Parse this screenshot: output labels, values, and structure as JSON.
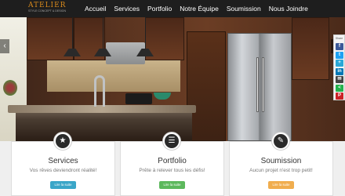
{
  "logo": {
    "name": "ATELIER",
    "tagline": "STYLE CONCEPT & DESIGN"
  },
  "nav": {
    "items": [
      "Accueil",
      "Services",
      "Portfolio",
      "Notre Équipe",
      "Soumission",
      "Nous Joindre"
    ]
  },
  "hero": {
    "prev_icon": "chevron-left-icon",
    "next_icon": "chevron-right-icon"
  },
  "share": {
    "label": "Share",
    "buttons": [
      {
        "icon": "facebook-icon",
        "glyph": "f",
        "color": "#3b5998"
      },
      {
        "icon": "twitter-icon",
        "glyph": "t",
        "color": "#1da1f2"
      },
      {
        "icon": "share-icon",
        "glyph": "+",
        "color": "#2aa7d6"
      },
      {
        "icon": "linkedin-icon",
        "glyph": "in",
        "color": "#0077b5"
      },
      {
        "icon": "email-icon",
        "glyph": "✉",
        "color": "#444444"
      },
      {
        "icon": "sharethis-icon",
        "glyph": "<",
        "color": "#22b14c"
      },
      {
        "icon": "pinterest-icon",
        "glyph": "P",
        "color": "#cb2027"
      }
    ]
  },
  "features": [
    {
      "icon": "star-icon",
      "title": "Services",
      "desc": "Vos rêves deviendront réalité!",
      "button": "Lire la suite",
      "button_color": "#3aa6c8"
    },
    {
      "icon": "list-icon",
      "title": "Portfolio",
      "desc": "Prête à relever tous les défis!",
      "button": "Lire la suite",
      "button_color": "#5cb85c"
    },
    {
      "icon": "edit-icon",
      "title": "Soumission",
      "desc": "Aucun projet n'est trop petit!",
      "button": "Lire la suite",
      "button_color": "#f0ad4e"
    }
  ]
}
